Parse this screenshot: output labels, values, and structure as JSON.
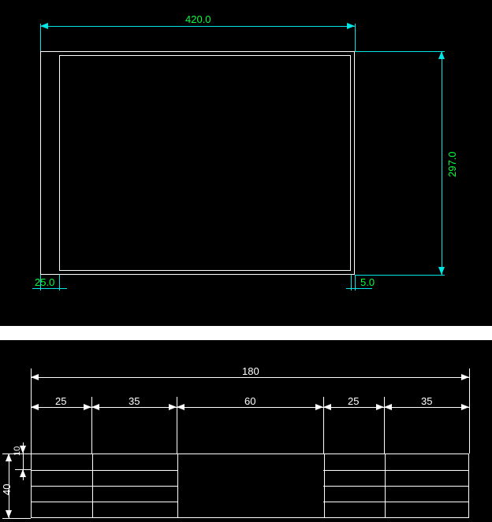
{
  "top": {
    "dim_width": "420.0",
    "dim_height": "297.0",
    "dim_left_margin": "25.0",
    "dim_right_margin": "5.0"
  },
  "bottom": {
    "dim_total": "180",
    "dim_c1": "25",
    "dim_c2": "35",
    "dim_c3": "60",
    "dim_c4": "25",
    "dim_c5": "35",
    "dim_row_small": "10",
    "dim_height": "40"
  }
}
